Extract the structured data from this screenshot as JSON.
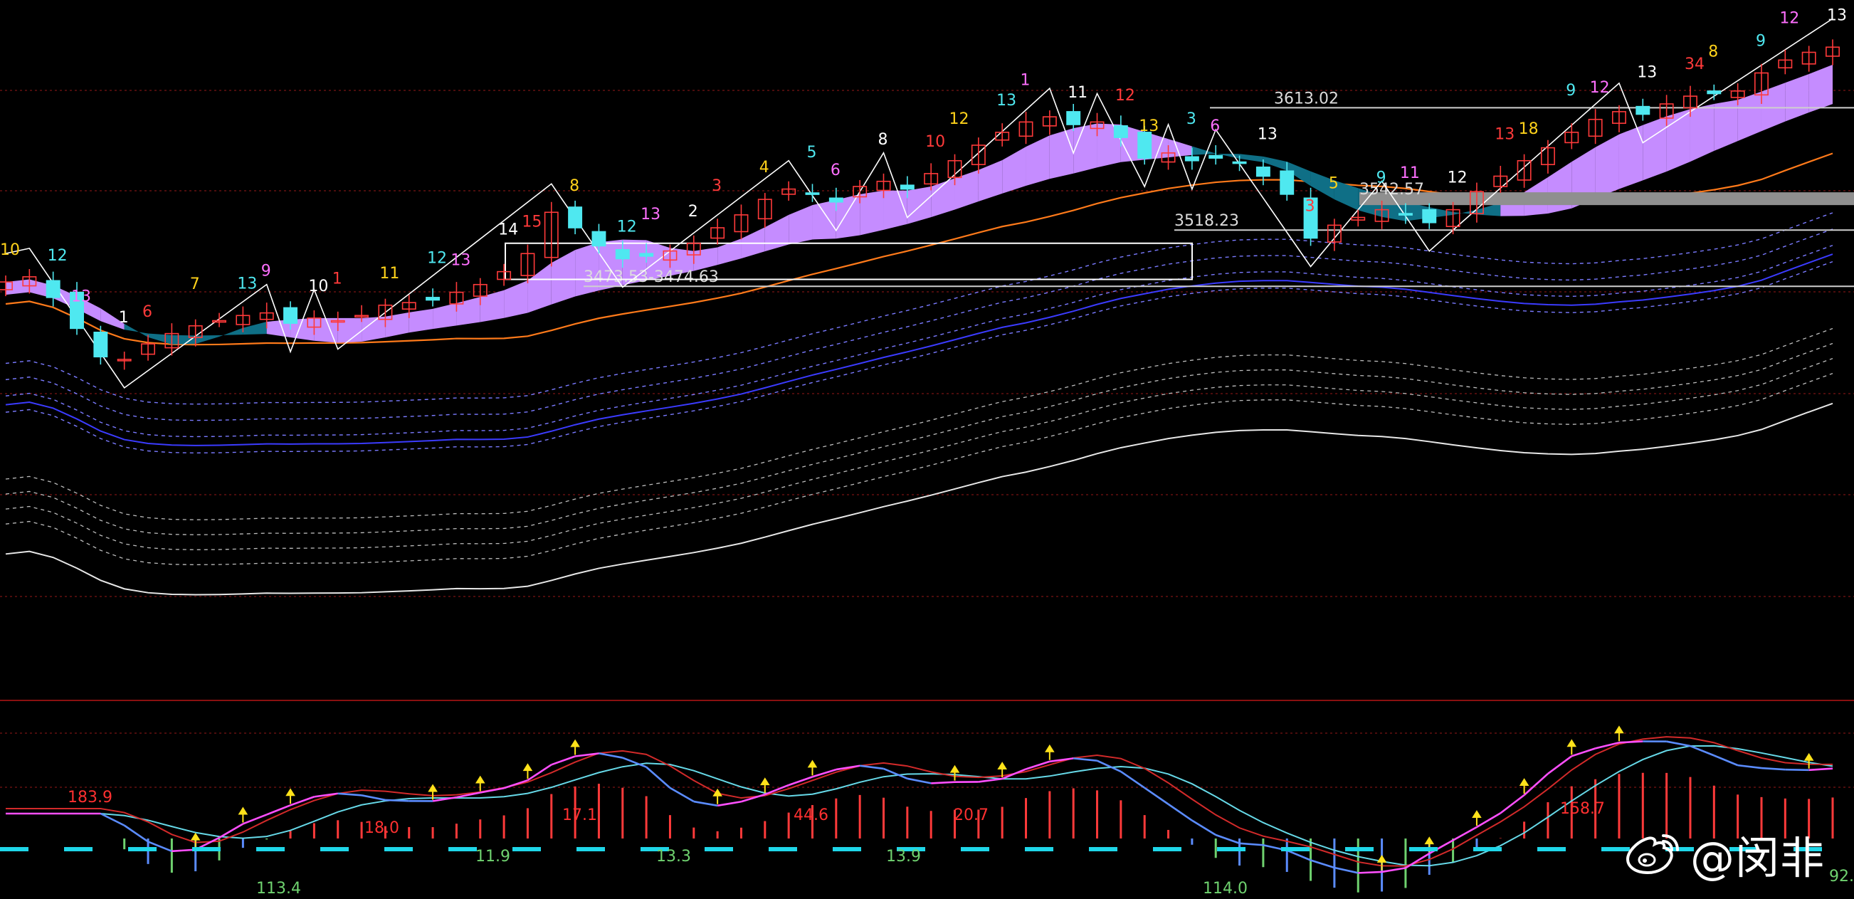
{
  "chart_data": [
    {
      "type": "candlestick",
      "panel": "price",
      "ylim": [
        3200,
        3680
      ],
      "grid": true,
      "colors": {
        "up": "#ff3a3a",
        "down": "#4fe8f0",
        "ribbon_up": "#c58cff",
        "ribbon_down": "#0f6f86",
        "ma_orange": "#ff7a1a",
        "ma_blue": "#3b3bff",
        "ma_white": "#e8e8e8",
        "zigzag": "#ffffff",
        "grid": "#7a1414"
      },
      "close": [
        3478,
        3482,
        3466,
        3442,
        3420,
        3418,
        3430,
        3438,
        3444,
        3448,
        3452,
        3454,
        3446,
        3450,
        3448,
        3452,
        3460,
        3462,
        3464,
        3470,
        3476,
        3486,
        3500,
        3532,
        3520,
        3506,
        3496,
        3498,
        3502,
        3508,
        3520,
        3530,
        3542,
        3550,
        3546,
        3540,
        3552,
        3556,
        3550,
        3562,
        3572,
        3584,
        3594,
        3602,
        3606,
        3600,
        3602,
        3590,
        3574,
        3578,
        3572,
        3574,
        3570,
        3560,
        3546,
        3512,
        3522,
        3528,
        3534,
        3530,
        3524,
        3534,
        3548,
        3560,
        3572,
        3582,
        3594,
        3604,
        3610,
        3608,
        3616,
        3622,
        3624,
        3626,
        3640,
        3650,
        3656,
        3660
      ],
      "levels": [
        {
          "value": 3613.02,
          "label": "3613.02"
        },
        {
          "value": 3542.57,
          "label": "3542.57"
        },
        {
          "value": 3518.23,
          "label": "3518.23"
        },
        {
          "value": 3474.63,
          "label": "3473.53-3474.63"
        }
      ],
      "labels": [
        "10",
        "12",
        "13",
        "1",
        "6",
        "7",
        "13",
        "9",
        "10",
        "1",
        "11",
        "12",
        "13",
        "14",
        "15",
        "8",
        "12",
        "13",
        "2",
        "3",
        "4",
        "5",
        "6",
        "8",
        "10",
        "12",
        "13",
        "1",
        "11",
        "12",
        "13",
        "3",
        "6",
        "13",
        "3",
        "5",
        "9",
        "11",
        "12",
        "13",
        "18",
        "9",
        "12",
        "13",
        "34",
        "8",
        "9",
        "12",
        "13"
      ]
    },
    {
      "type": "macd",
      "panel": "indicator",
      "ylim": [
        -120,
        200
      ],
      "colors": {
        "pos_bar": "#ff3a3a",
        "neg_bar": "#6fd26f",
        "neg_bar_alt": "#5b8cff",
        "signal_up": "#ff4fff",
        "signal_down": "#5b8cff",
        "dea": "#66d9e8",
        "fast": "#d22a2a",
        "dashes": "#1fd6e8",
        "arrow": "#ffe21a"
      },
      "annotations": [
        {
          "text": "183.9",
          "color": "#ff3030"
        },
        {
          "text": "18.0",
          "color": "#ff3030"
        },
        {
          "text": "17.1",
          "color": "#ff3030"
        },
        {
          "text": "44.6",
          "color": "#ff3030"
        },
        {
          "text": "20.7",
          "color": "#ff3030"
        },
        {
          "text": "158.7",
          "color": "#ff3030"
        },
        {
          "text": "113.4",
          "color": "#6fd26f"
        },
        {
          "text": "11.9",
          "color": "#6fd26f"
        },
        {
          "text": "13.3",
          "color": "#6fd26f"
        },
        {
          "text": "13.9",
          "color": "#6fd26f"
        },
        {
          "text": "114.0",
          "color": "#6fd26f"
        },
        {
          "text": "92.",
          "color": "#6fd26f"
        }
      ]
    }
  ],
  "watermark": {
    "text": "@闵非",
    "icon": "weibo-icon"
  }
}
